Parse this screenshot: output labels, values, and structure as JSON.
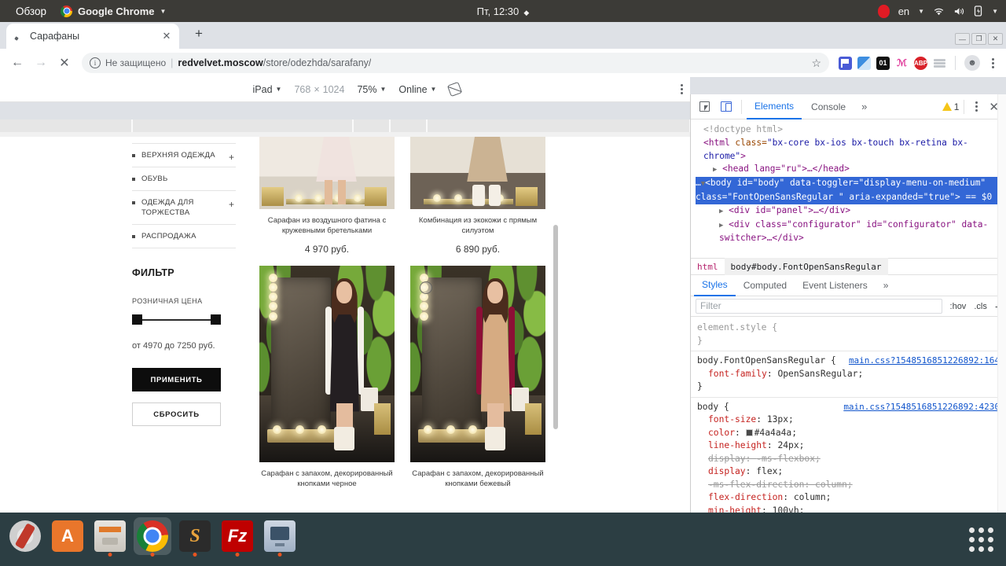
{
  "desktop": {
    "activities": "Обзор",
    "app_name": "Google Chrome",
    "clock": "Пт, 12:30",
    "keyboard_layout": "en",
    "icons": {
      "chrome": "chrome-logo-icon",
      "record": "record-dot-icon",
      "wifi": "wifi-icon",
      "volume": "volume-icon",
      "battery": "battery-icon",
      "caret": "chevron-down-icon"
    }
  },
  "browser": {
    "tab": {
      "title": "Сарафаны",
      "close": "✕"
    },
    "new_tab": "+",
    "window_controls": {
      "minimize": "—",
      "maximize": "❐",
      "close": "✕"
    },
    "nav": {
      "back": "←",
      "forward": "→",
      "stop": "✕"
    },
    "omnibox": {
      "security_label": "Не защищено",
      "separator": "|",
      "url_domain": "redvelvet.moscow",
      "url_path": "/store/odezhda/sarafany/",
      "star": "☆"
    },
    "extensions": [
      "flag-extension-icon",
      "blue-page-extension-icon",
      "counter-01-extension-icon",
      "pink-extension-icon",
      "adblock-plus-icon",
      "layers-extension-icon"
    ],
    "abp_label": "ABP",
    "counter_label": "01",
    "profile": "avatar-icon",
    "menu": "kebab-menu-icon"
  },
  "device_toolbar": {
    "device": "iPad",
    "width": "768",
    "times": "×",
    "height": "1024",
    "zoom": "75%",
    "throttling": "Online",
    "rotate": "rotate-icon",
    "menu": "kebab-menu-icon"
  },
  "site": {
    "categories": [
      {
        "label": "ВЕРХНЯЯ ОДЕЖДА",
        "expand": "+"
      },
      {
        "label": "ОБУВЬ",
        "expand": ""
      },
      {
        "label": "ОДЕЖДА ДЛЯ ТОРЖЕСТВА",
        "expand": "+"
      },
      {
        "label": "РАСПРОДАЖА",
        "expand": ""
      }
    ],
    "filter_title": "ФИЛЬТР",
    "price_label": "РОЗНИЧНАЯ ЦЕНА",
    "price_range": "от 4970 до 7250 руб.",
    "apply_button": "ПРИМЕНИТЬ",
    "reset_button": "СБРОСИТЬ",
    "products": [
      {
        "name": "Сарафан из воздушного фатина с кружевными бретельками",
        "price": "4 970 руб."
      },
      {
        "name": "Комбинация из экокожи с прямым силуэтом",
        "price": "6 890 руб."
      },
      {
        "name": "Сарафан с запахом, декорированный кнопками черное",
        "price": ""
      },
      {
        "name": "Сарафан с запахом, декорированный кнопками бежевый",
        "price": ""
      }
    ]
  },
  "devtools": {
    "tabs": [
      {
        "label": "Elements",
        "active": true
      },
      {
        "label": "Console",
        "active": false
      }
    ],
    "more_tabs": "»",
    "warning_count": "1",
    "close": "✕",
    "dom": {
      "line1": "<!doctype html>",
      "line2_tag": "<html",
      "line2_attr": " class=",
      "line2_val": "\"bx-core bx-ios bx-touch bx-retina bx-chrome\"",
      "line2_end": ">",
      "line3": "<head lang=\"ru\">…</head>",
      "sel_tag": "<body",
      "sel_attrs": " id=\"body\" data-toggler=\"display-menu-on-medium\" class=\"FontOpenSansRegular \" aria-expanded=\"true\">",
      "sel_marker": "== $0",
      "line5": "<div id=\"panel\">…</div>",
      "line6": "<div class=\"configurator\" id=\"configurator\" data-switcher>…</div>"
    },
    "breadcrumbs": [
      "html",
      "body#body.FontOpenSansRegular"
    ],
    "style_tabs": [
      {
        "label": "Styles",
        "active": true
      },
      {
        "label": "Computed",
        "active": false
      },
      {
        "label": "Event Listeners",
        "active": false
      },
      {
        "label": "»",
        "active": false
      }
    ],
    "filter_placeholder": "Filter",
    "hov": ":hov",
    "cls": ".cls",
    "plus": "+",
    "rules": [
      {
        "selector": "element.style {",
        "source": "",
        "declarations": [],
        "close": "}"
      },
      {
        "selector": "body.FontOpenSansRegular {",
        "source": "main.css?1548516851226892:164",
        "declarations": [
          {
            "prop": "font-family",
            "value": "OpenSansRegular;",
            "strike": false,
            "swatch": false
          }
        ],
        "close": "}"
      },
      {
        "selector": "body {",
        "source": "main.css?1548516851226892:4230",
        "declarations": [
          {
            "prop": "font-size",
            "value": "13px;",
            "strike": false,
            "swatch": false
          },
          {
            "prop": "color",
            "value": "#4a4a4a;",
            "strike": false,
            "swatch": true
          },
          {
            "prop": "line-height",
            "value": "24px;",
            "strike": false,
            "swatch": false
          },
          {
            "prop": "display",
            "value": "-ms-flexbox;",
            "strike": true,
            "swatch": false
          },
          {
            "prop": "display",
            "value": "flex;",
            "strike": false,
            "swatch": false
          },
          {
            "prop": "-ms-flex-direction",
            "value": "column;",
            "strike": true,
            "swatch": false
          },
          {
            "prop": "flex-direction",
            "value": "column;",
            "strike": false,
            "swatch": false
          },
          {
            "prop": "min-height",
            "value": "100vh;",
            "strike": false,
            "swatch": false
          }
        ],
        "close": ""
      }
    ]
  },
  "launcher": {
    "apps": [
      "settings-icon",
      "ubuntu-software-icon",
      "files-icon",
      "google-chrome-icon",
      "sublime-text-icon",
      "filezilla-icon",
      "remote-desktop-icon"
    ],
    "show_apps": "app-grid-icon"
  },
  "colors": {
    "accent": "#1a73e8",
    "topbar": "#3c3b37",
    "launcher": "#2c3e43",
    "site_button": "#0d0d0d",
    "body_color": "#4a4a4a"
  }
}
